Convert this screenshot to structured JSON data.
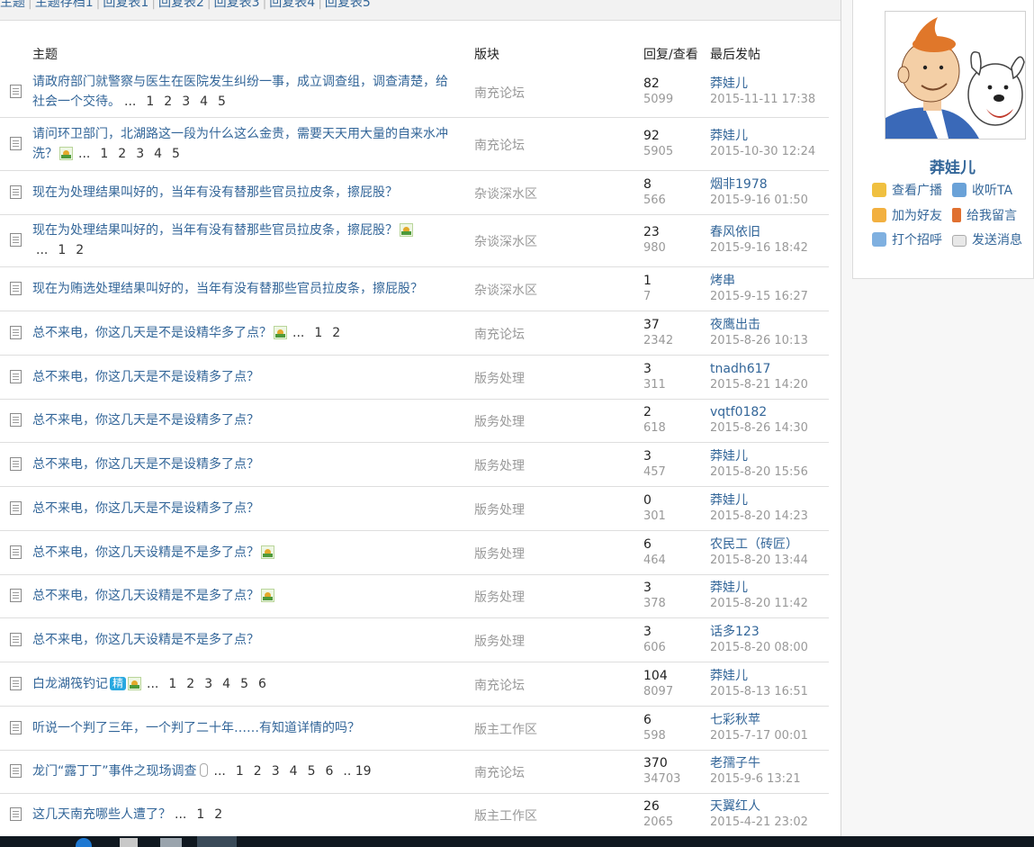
{
  "tabs": [
    "主题",
    "主题存档1",
    "回复表1",
    "回复表2",
    "回复表3",
    "回复表4",
    "回复表5"
  ],
  "table_header": {
    "title": "主题",
    "forum": "版块",
    "replies_views": "回复/查看",
    "last_post": "最后发帖"
  },
  "rows": [
    {
      "title": "请政府部门就警察与医生在医院发生纠纷一事，成立调查组，调查清楚，给社会一个交待。",
      "ellipsis": "...",
      "pages": [
        "1",
        "2",
        "3",
        "4",
        "5"
      ],
      "forum": "南充论坛",
      "replies": "82",
      "views": "5099",
      "last_user": "莽娃儿",
      "last_time": "2015-11-11 17:38"
    },
    {
      "title": "请问环卫部门，北湖路这一段为什么这么金贵，需要天天用大量的自来水冲洗？",
      "ellipsis": "...",
      "pages": [
        "1",
        "2",
        "3",
        "4",
        "5"
      ],
      "forum": "南充论坛",
      "replies": "92",
      "views": "5905",
      "last_user": "莽娃儿",
      "last_time": "2015-10-30 12:24"
    },
    {
      "title": "现在为处理结果叫好的，当年有没有替那些官员拉皮条，擦屁股？",
      "forum": "杂谈深水区",
      "replies": "8",
      "views": "566",
      "last_user": "烟非1978",
      "last_time": "2015-9-16 01:50"
    },
    {
      "title": "现在为处理结果叫好的，当年有没有替那些官员拉皮条，擦屁股？",
      "ellipsis": "...",
      "pages": [
        "1",
        "2"
      ],
      "forum": "杂谈深水区",
      "replies": "23",
      "views": "980",
      "last_user": "春风依旧",
      "last_time": "2015-9-16 18:42"
    },
    {
      "title": "现在为贿选处理结果叫好的，当年有没有替那些官员拉皮条，擦屁股？",
      "forum": "杂谈深水区",
      "replies": "1",
      "views": "7",
      "last_user": "烤串",
      "last_time": "2015-9-15 16:27"
    },
    {
      "title": "总不来电，你这几天是不是设精华多了点？",
      "ellipsis": "...",
      "pages": [
        "1",
        "2"
      ],
      "forum": "南充论坛",
      "replies": "37",
      "views": "2342",
      "last_user": "夜鹰出击",
      "last_time": "2015-8-26 10:13"
    },
    {
      "title": "总不来电，你这几天是不是设精多了点？",
      "forum": "版务处理",
      "replies": "3",
      "views": "311",
      "last_user": "tnadh617",
      "last_time": "2015-8-21 14:20"
    },
    {
      "title": "总不来电，你这几天是不是设精多了点？",
      "forum": "版务处理",
      "replies": "2",
      "views": "618",
      "last_user": "vqtf0182",
      "last_time": "2015-8-26 14:30"
    },
    {
      "title": "总不来电，你这几天是不是设精多了点？",
      "forum": "版务处理",
      "replies": "3",
      "views": "457",
      "last_user": "莽娃儿",
      "last_time": "2015-8-20 15:56"
    },
    {
      "title": "总不来电，你这几天是不是设精多了点？",
      "forum": "版务处理",
      "replies": "0",
      "views": "301",
      "last_user": "莽娃儿",
      "last_time": "2015-8-20 14:23"
    },
    {
      "title": "总不来电，你这几天设精是不是多了点？",
      "forum": "版务处理",
      "replies": "6",
      "views": "464",
      "last_user": "农民工（砖匠）",
      "last_time": "2015-8-20 13:44"
    },
    {
      "title": "总不来电，你这几天设精是不是多了点？",
      "forum": "版务处理",
      "replies": "3",
      "views": "378",
      "last_user": "莽娃儿",
      "last_time": "2015-8-20 11:42"
    },
    {
      "title": "总不来电，你这几天设精是不是多了点？",
      "forum": "版务处理",
      "replies": "3",
      "views": "606",
      "last_user": "话多123",
      "last_time": "2015-8-20 08:00"
    },
    {
      "title": "白龙湖筏钓记",
      "badge": "精",
      "ellipsis": "...",
      "pages": [
        "1",
        "2",
        "3",
        "4",
        "5",
        "6"
      ],
      "forum": "南充论坛",
      "replies": "104",
      "views": "8097",
      "last_user": "莽娃儿",
      "last_time": "2015-8-13 16:51"
    },
    {
      "title": "听说一个判了三年，一个判了二十年……有知道详情的吗？",
      "forum": "版主工作区",
      "replies": "6",
      "views": "598",
      "last_user": "七彩秋苹",
      "last_time": "2015-7-17 00:01"
    },
    {
      "title": "龙门“露丁丁”事件之现场调查",
      "ellipsis": "...",
      "pages": [
        "1",
        "2",
        "3",
        "4",
        "5",
        "6",
        ".. 19"
      ],
      "forum": "南充论坛",
      "replies": "370",
      "views": "34703",
      "last_user": "老孺子牛",
      "last_time": "2015-9-6 13:21"
    },
    {
      "title": "这几天南充哪些人遭了？",
      "ellipsis": "...",
      "pages": [
        "1",
        "2"
      ],
      "forum": "版主工作区",
      "replies": "26",
      "views": "2065",
      "last_user": "天翼红人",
      "last_time": "2015-4-21 23:02"
    }
  ],
  "profile": {
    "username": "莽娃儿",
    "actions": [
      "查看广播",
      "收听TA",
      "加为好友",
      "给我留言",
      "打个招呼",
      "发送消息"
    ]
  },
  "colors": {
    "link": "#336699",
    "muted": "#999999",
    "badge": "#27a8e0",
    "taskbar": "#101820"
  }
}
